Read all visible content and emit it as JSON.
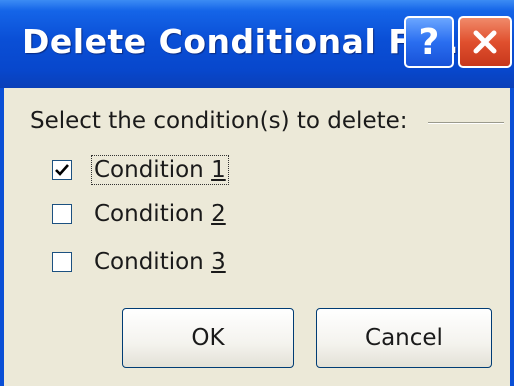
{
  "dialog": {
    "title": "Delete Conditional Fo...",
    "help_symbol": "?",
    "prompt": "Select the condition(s) to delete:"
  },
  "conditions": [
    {
      "prefix": "Condition ",
      "accel": "1",
      "checked": true
    },
    {
      "prefix": "Condition ",
      "accel": "2",
      "checked": false
    },
    {
      "prefix": "Condition ",
      "accel": "3",
      "checked": false
    }
  ],
  "buttons": {
    "ok": "OK",
    "cancel": "Cancel"
  },
  "colors": {
    "titlebar": "#0a4fd6",
    "dialog_bg": "#ece9d8",
    "close_button": "#e0502e"
  }
}
